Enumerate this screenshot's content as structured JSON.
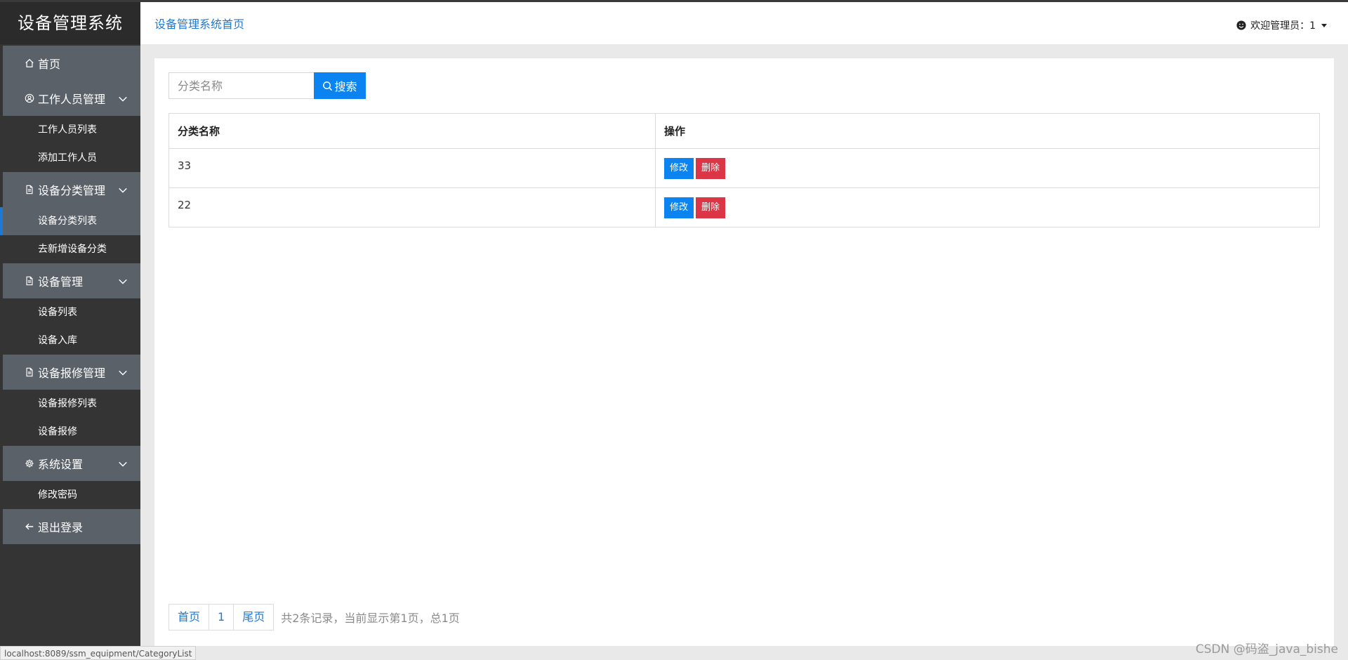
{
  "sidebar": {
    "brand": "设备管理系统",
    "home": "首页",
    "groups": [
      {
        "title": "工作人员管理",
        "icon": "user-circle-icon",
        "items": [
          "工作人员列表",
          "添加工作人员"
        ]
      },
      {
        "title": "设备分类管理",
        "icon": "document-icon",
        "items": [
          "设备分类列表",
          "去新增设备分类"
        ]
      },
      {
        "title": "设备管理",
        "icon": "document-icon",
        "items": [
          "设备列表",
          "设备入库"
        ]
      },
      {
        "title": "设备报修管理",
        "icon": "document-icon",
        "items": [
          "设备报修列表",
          "设备报修"
        ]
      },
      {
        "title": "系统设置",
        "icon": "gear-icon",
        "items": [
          "修改密码"
        ]
      }
    ],
    "logout": "退出登录",
    "active_item": "设备分类列表"
  },
  "header": {
    "breadcrumb": "设备管理系统首页",
    "welcome": "欢迎管理员：1"
  },
  "search": {
    "placeholder": "分类名称",
    "value": "",
    "button_label": "搜索"
  },
  "table": {
    "columns": [
      "分类名称",
      "操作"
    ],
    "rows": [
      {
        "name": "33",
        "edit_label": "修改",
        "delete_label": "删除"
      },
      {
        "name": "22",
        "edit_label": "修改",
        "delete_label": "删除"
      }
    ]
  },
  "pagination": {
    "first": "首页",
    "current_page": "1",
    "last": "尾页",
    "info": "共2条记录，当前显示第1页，总1页"
  },
  "statusbar": {
    "url": "localhost:8089/ssm_equipment/CategoryList"
  },
  "watermark": "CSDN @码盗_java_bishe",
  "colors": {
    "sidebar_bg": "#343434",
    "menu_head_bg": "#5b6169",
    "primary": "#0b84f2",
    "danger": "#dc3545",
    "link": "#1e78d6"
  }
}
